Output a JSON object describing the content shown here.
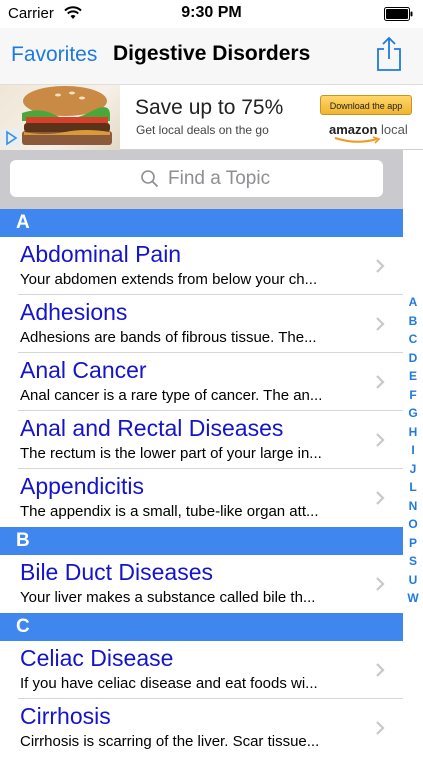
{
  "status_bar": {
    "carrier": "Carrier",
    "time": "9:30 PM"
  },
  "nav": {
    "back_label": "Favorites",
    "title": "Digestive Disorders",
    "action_icon": "share-icon"
  },
  "ad": {
    "headline": "Save up to 75%",
    "subline": "Get local deals on the go",
    "cta": "Download the app",
    "brand": "amazon",
    "brand_suffix": "local"
  },
  "search": {
    "placeholder": "Find a Topic"
  },
  "sections": [
    {
      "letter": "A",
      "rows": [
        {
          "title": "Abdominal Pain",
          "desc": "Your abdomen extends from below your ch..."
        },
        {
          "title": "Adhesions",
          "desc": "Adhesions are bands of fibrous tissue. The..."
        },
        {
          "title": "Anal Cancer",
          "desc": "Anal cancer is a rare type of cancer. The an..."
        },
        {
          "title": "Anal and Rectal Diseases",
          "desc": "The rectum is the lower part of your large in..."
        },
        {
          "title": "Appendicitis",
          "desc": "The appendix is a small, tube-like organ att..."
        }
      ]
    },
    {
      "letter": "B",
      "rows": [
        {
          "title": "Bile Duct Diseases",
          "desc": "Your liver makes a substance called bile th..."
        }
      ]
    },
    {
      "letter": "C",
      "rows": [
        {
          "title": "Celiac Disease",
          "desc": "If you have celiac disease and eat foods wi..."
        },
        {
          "title": "Cirrhosis",
          "desc": "Cirrhosis is scarring of the liver. Scar tissue..."
        }
      ]
    }
  ],
  "index_letters": [
    "A",
    "B",
    "C",
    "D",
    "E",
    "F",
    "G",
    "H",
    "I",
    "J",
    "L",
    "N",
    "O",
    "P",
    "S",
    "U",
    "W"
  ],
  "colors": {
    "accent": "#1f7ae0",
    "section_header": "#3f86ef",
    "row_title": "#1414cc"
  }
}
